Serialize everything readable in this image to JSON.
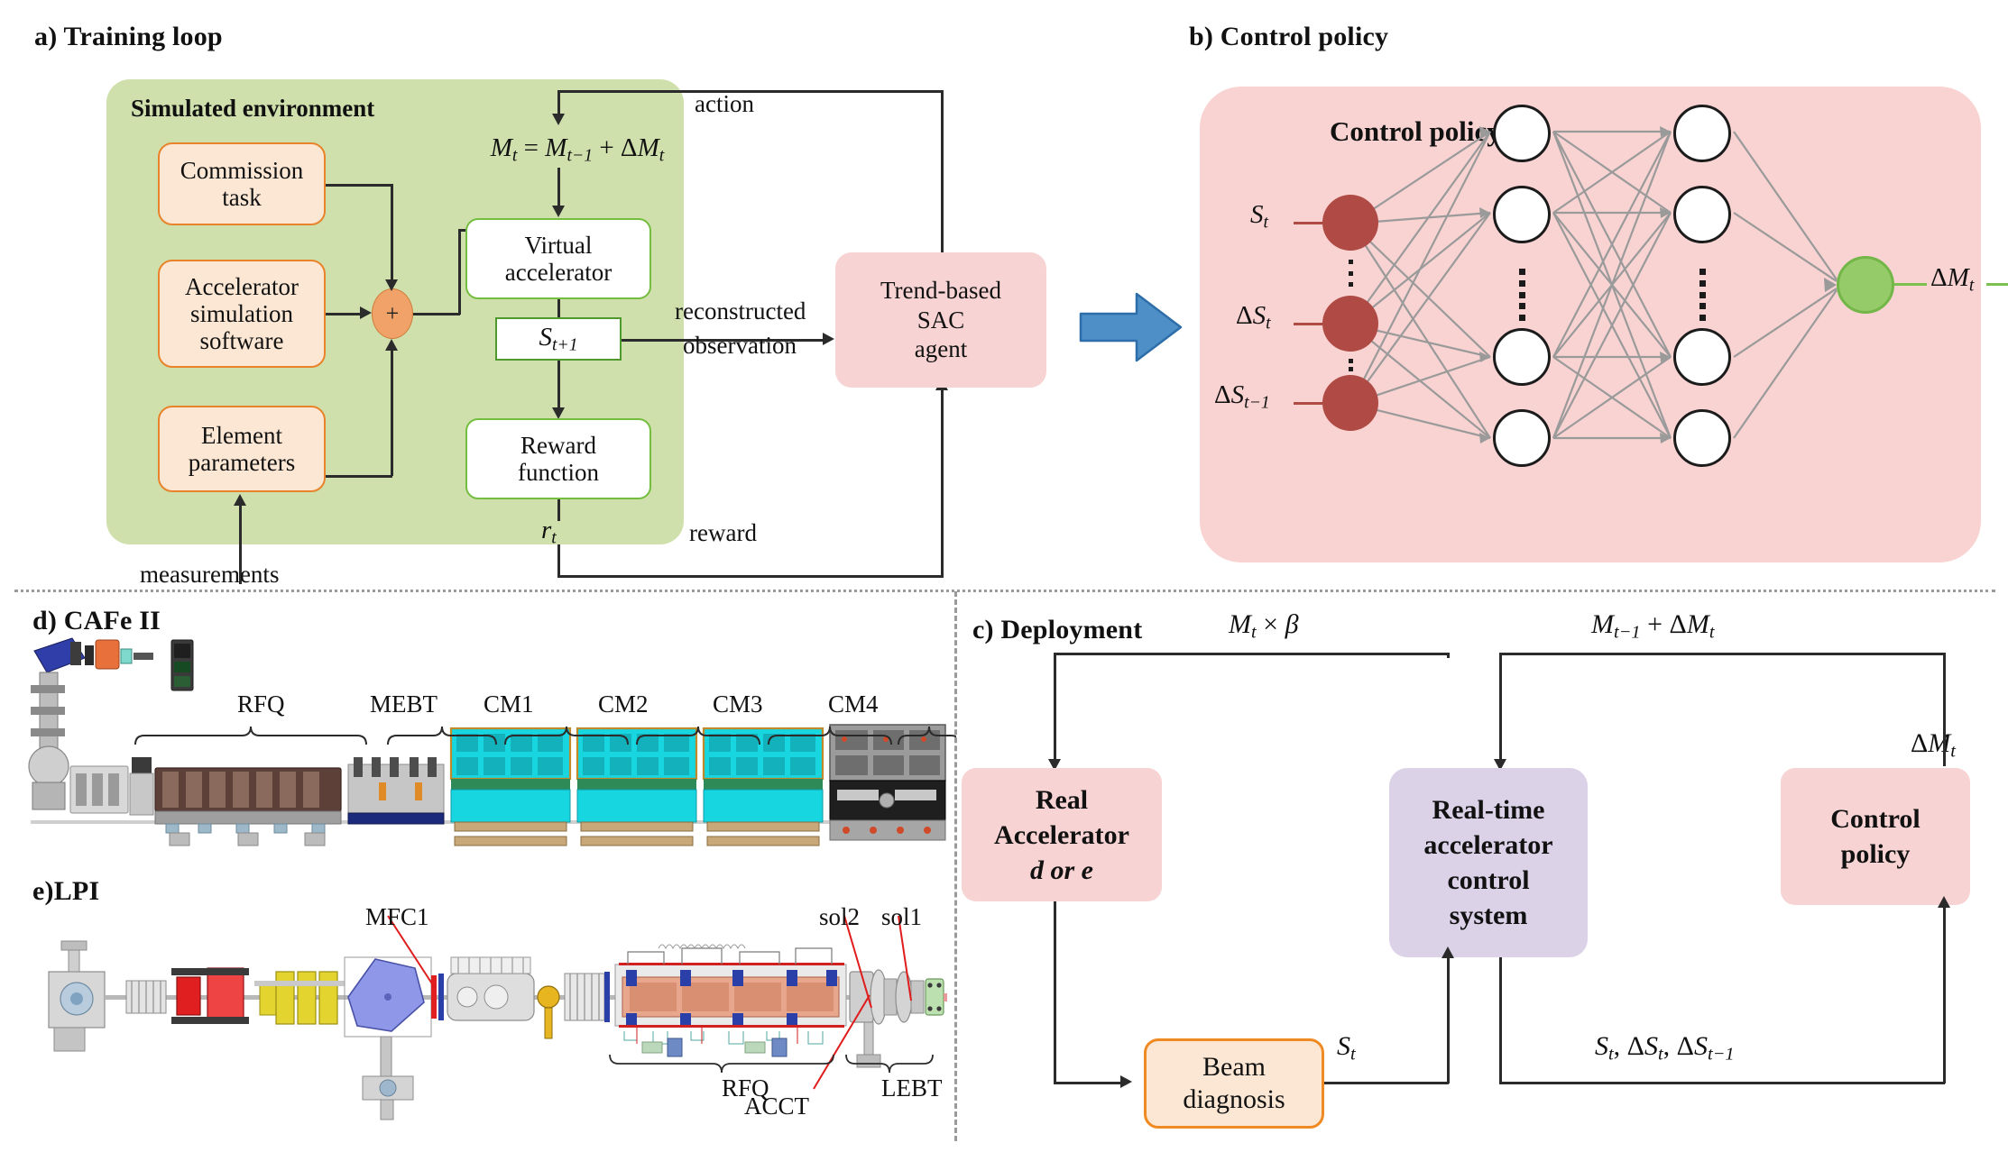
{
  "panels": {
    "a": {
      "caption": "a) Training loop"
    },
    "b": {
      "caption": "b) Control policy"
    },
    "c": {
      "caption": "c) Deployment"
    },
    "d": {
      "caption": "d) CAFe  II"
    },
    "e": {
      "caption": "e)LPI"
    }
  },
  "training_loop": {
    "env_title": "Simulated environment",
    "boxes": {
      "commission_task": "Commission\ntask",
      "commission_task_l1": "Commission",
      "commission_task_l2": "task",
      "accel_sim_l1": "Accelerator",
      "accel_sim_l2": "simulation",
      "accel_sim_l3": "software",
      "element_params_l1": "Element",
      "element_params_l2": "parameters",
      "virtual_accel_l1": "Virtual",
      "virtual_accel_l2": "accelerator",
      "reward_fn_l1": "Reward",
      "reward_fn_l2": "function",
      "agent_l1": "Trend-based",
      "agent_l2": "SAC",
      "agent_l3": "agent",
      "plus": "+"
    },
    "math": {
      "update_rule": "M_t = M_{t-1} + ΔM_t",
      "state_next": "S_{t+1}",
      "reward_symbol": "r_t"
    },
    "edge_labels": {
      "action": "action",
      "reconstructed": "reconstructed",
      "observation": "observation",
      "reward": "reward",
      "measurements": "measurements"
    }
  },
  "control_policy": {
    "title": "Control policy",
    "inputs": [
      "S_t",
      "ΔS_t",
      "ΔS_{t-1}"
    ],
    "output": "ΔM_t",
    "input_node_count": 3,
    "hidden_layers": 2,
    "hidden_nodes_shown_per_layer": 4,
    "output_node_count": 1,
    "colors": {
      "panel": "#f8d3d2",
      "input_node": "#b04a44",
      "hidden_node": "#ffffff",
      "output_node": "#96cb6a",
      "connection": "#9a9a9a",
      "transition_arrow": "#4e8fc8"
    }
  },
  "deployment": {
    "boxes": {
      "real_accel_l1": "Real",
      "real_accel_l2": "Accelerator",
      "real_accel_l3": "d or e",
      "rtacs_l1": "Real-time",
      "rtacs_l2": "accelerator",
      "rtacs_l3": "control",
      "rtacs_l4": "system",
      "control_policy_l1": "Control",
      "control_policy_l2": "policy",
      "beam_diag_l1": "Beam",
      "beam_diag_l2": "diagnosis"
    },
    "edge_labels": {
      "scaled_setting": "M_t × β",
      "accumulate": "M_{t-1} + ΔM_t",
      "delta_m": "ΔM_t",
      "state": "S_t",
      "obs_triplet": "S_t, ΔS_t, ΔS_{t-1}"
    },
    "colors": {
      "pink": "#f7d3d3",
      "purple": "#dcd2e8",
      "orange_fill": "#fce7d4",
      "orange_stroke": "#ef8a22"
    }
  },
  "cafe2": {
    "caption": "d) CAFe  II",
    "section_labels": [
      "RFQ",
      "MEBT",
      "CM1",
      "CM2",
      "CM3",
      "CM4"
    ]
  },
  "lpi": {
    "caption": "e)LPI",
    "callouts": [
      "MFC1",
      "sol2",
      "sol1",
      "ACCT"
    ],
    "section_labels": [
      "RFQ",
      "LEBT"
    ]
  }
}
